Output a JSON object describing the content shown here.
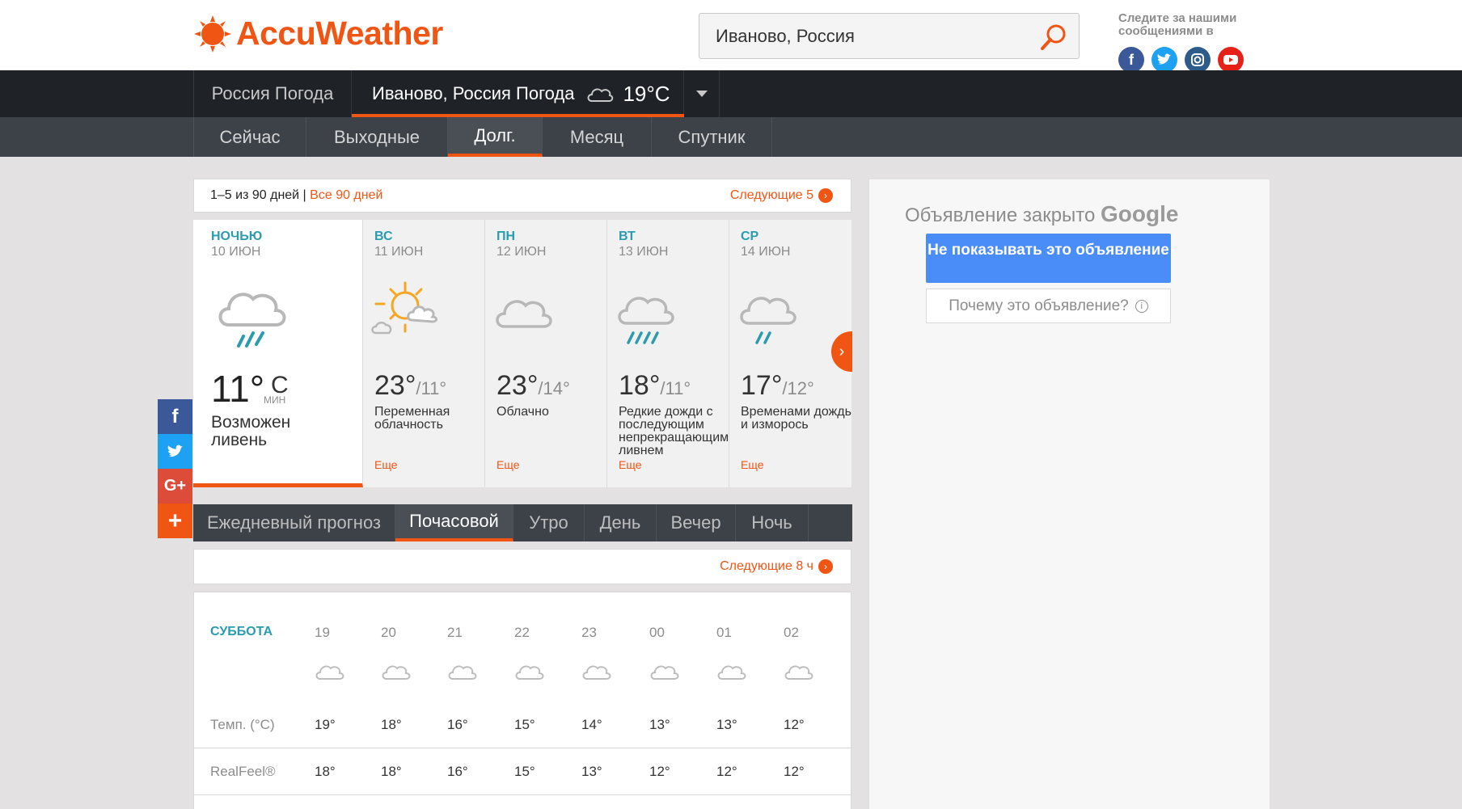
{
  "header": {
    "logo_text": "AccuWeather",
    "search_value": "Иваново, Россия",
    "follow_text": "Следите за нашими сообщениями в",
    "socials": [
      "facebook-icon",
      "twitter-icon",
      "instagram-icon",
      "youtube-icon"
    ]
  },
  "nav1": {
    "country": "Россия Погода",
    "city": "Иваново, Россия Погода",
    "temp": "19°C"
  },
  "nav2": {
    "items": [
      "Сейчас",
      "Выходные",
      "Долг.",
      "Месяц",
      "Спутник"
    ],
    "active": "Долг."
  },
  "range_bar": {
    "count": "1–5 из 90 дней |",
    "all_link": "Все 90 дней",
    "next_link": "Следующие 5"
  },
  "days": [
    {
      "name": "НОЧЬЮ",
      "date": "10 ИЮН",
      "temp": "11°",
      "unit": "C",
      "min": "МИН",
      "desc": "Возможен ливень"
    },
    {
      "name": "ВС",
      "date": "11 ИЮН",
      "hi": "23°",
      "lo": "/11°",
      "desc": "Переменная облачность",
      "more": "Еще"
    },
    {
      "name": "ПН",
      "date": "12 ИЮН",
      "hi": "23°",
      "lo": "/14°",
      "desc": "Облачно",
      "more": "Еще"
    },
    {
      "name": "ВТ",
      "date": "13 ИЮН",
      "hi": "18°",
      "lo": "/11°",
      "desc": "Редкие дожди с последующим непрекращающим ливнем",
      "more": "Еще"
    },
    {
      "name": "СР",
      "date": "14 ИЮН",
      "hi": "17°",
      "lo": "/12°",
      "desc": "Временами дождь и изморось",
      "more": "Еще"
    }
  ],
  "tabs": {
    "items": [
      "Ежедневный прогноз",
      "Почасовой",
      "Утро",
      "День",
      "Вечер",
      "Ночь"
    ],
    "active": "Почасовой"
  },
  "hourly_nav": {
    "next_link": "Следующие 8 ч"
  },
  "hourly": {
    "day": "СУББОТА",
    "hours": [
      "19",
      "20",
      "21",
      "22",
      "23",
      "00",
      "01",
      "02"
    ],
    "temp_label": "Темп. (°C)",
    "temps": [
      "19°",
      "18°",
      "16°",
      "15°",
      "14°",
      "13°",
      "13°",
      "12°"
    ],
    "realfeel_label": "RealFeel®",
    "realfeel": [
      "18°",
      "18°",
      "16°",
      "15°",
      "13°",
      "12°",
      "12°",
      "12°"
    ]
  },
  "ad": {
    "closed_text": "Объявление закрыто",
    "google": "Google",
    "hide_button": "Не показывать это объявление",
    "why_button": "Почему это объявление?"
  },
  "share": [
    "facebook-icon",
    "twitter-icon",
    "google-plus-icon",
    "plus-icon"
  ],
  "colors": {
    "accent": "#f05514",
    "nav_dark": "#1f2227",
    "nav_mid": "#3d4249",
    "teal": "#2a9cae",
    "ad_blue": "#4b8df8"
  }
}
